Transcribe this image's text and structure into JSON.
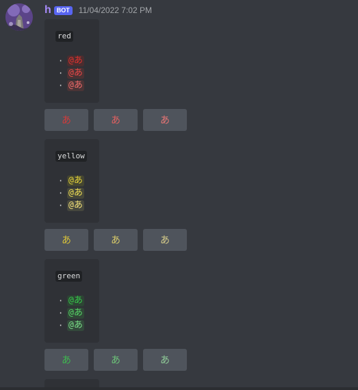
{
  "message": {
    "username": "h",
    "bot_tag": "BOT",
    "timestamp": "11/04/2022 7:02 PM"
  },
  "colors": {
    "username": "#a78bfa",
    "bot_tag_bg": "#5865f2",
    "background": "#36393f",
    "embed_bg": "#2f3136",
    "button_bg": "#4f545c"
  },
  "embeds": [
    {
      "title": "red",
      "bullet": "·",
      "mentions": [
        "@あ",
        "@あ",
        "@あ"
      ],
      "mention_colors": [
        "#e0322e",
        "#e84747",
        "#f06b6b"
      ],
      "mention_bgs": [
        "#4a2d2f",
        "#4a3234",
        "#4a3436"
      ],
      "buttons": [
        "あ",
        "あ",
        "あ"
      ],
      "button_colors": [
        "#d23b3b",
        "#e06060",
        "#e87575"
      ]
    },
    {
      "title": "yellow",
      "bullet": "·",
      "mentions": [
        "@あ",
        "@あ",
        "@あ"
      ],
      "mention_colors": [
        "#e8d53a",
        "#f0df55",
        "#f4e27a"
      ],
      "mention_bgs": [
        "#444531",
        "#45463a",
        "#46473e"
      ],
      "buttons": [
        "あ",
        "あ",
        "あ"
      ],
      "button_colors": [
        "#d8c23a",
        "#d8ca6a",
        "#d6cc8a"
      ]
    },
    {
      "title": "green",
      "bullet": "·",
      "mentions": [
        "@あ",
        "@あ",
        "@あ"
      ],
      "mention_colors": [
        "#36c94a",
        "#55d466",
        "#7adf88"
      ],
      "mention_bgs": [
        "#2d4434",
        "#304637",
        "#33483b"
      ],
      "buttons": [
        "あ",
        "あ",
        "あ"
      ],
      "button_colors": [
        "#3fb850",
        "#6cc378",
        "#8fcb98"
      ]
    }
  ]
}
